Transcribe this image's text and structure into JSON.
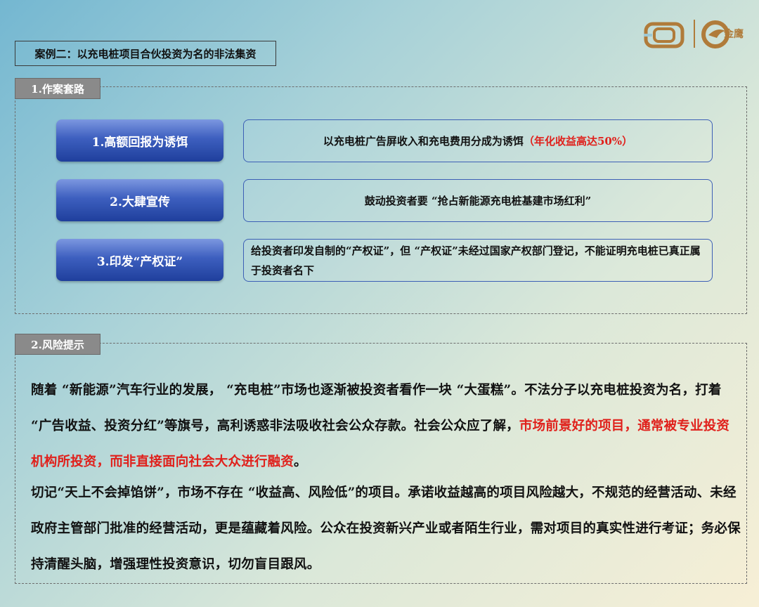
{
  "title": "案例二：以充电桩项目合伙投资为名的非法集资",
  "logo": {
    "brand_text": "金鹰",
    "icon_a": "ring-logo-icon",
    "icon_b": "eagle-logo-icon"
  },
  "section1": {
    "tag": "1.作案套路",
    "steps": [
      {
        "label": "1.高额回报为诱饵",
        "desc": "以充电桩广告屏收入和充电费用分成为诱饵",
        "desc_red": "（年化收益高达50%）"
      },
      {
        "label": "2.大肆宣传",
        "desc": "鼓动投资者要 “抢占新能源充电桩基建市场红利”",
        "desc_red": ""
      },
      {
        "label": "3.印发“产权证”",
        "desc": "给投资者印发自制的“产权证”，但 “产权证”未经过国家产权部门登记，不能证明充电桩已真正属于投资者名下",
        "desc_red": ""
      }
    ]
  },
  "section2": {
    "tag": "2.风险提示",
    "para1_normal": "随着 “新能源”汽车行业的发展， “充电桩”市场也逐渐被投资者看作一块 “大蛋糕”。不法分子以充电桩投资为名，打着 “广告收益、投资分红”等旗号，高利诱惑非法吸收社会公众存款。社会公众应了解，",
    "para1_red": "市场前景好的项目，通常被专业投资机构所投资，而非直接面向社会大众进行融资",
    "para1_end": "。",
    "para2": "切记“天上不会掉馅饼”，市场不存在 “收益高、风险低”的项目。承诺收益越高的项目风险越大，不规范的经营活动、未经政府主管部门批准的经营活动，更是蕴藏着风险。公众在投资新兴产业或者陌生行业，需对项目的真实性进行考证；务必保持清醒头脑，增强理性投资意识，切勿盲目跟风。"
  },
  "colors": {
    "accent_red": "#e0201b",
    "pill_blue": "#2f50b0",
    "logo_gold": "#b07b3a"
  }
}
